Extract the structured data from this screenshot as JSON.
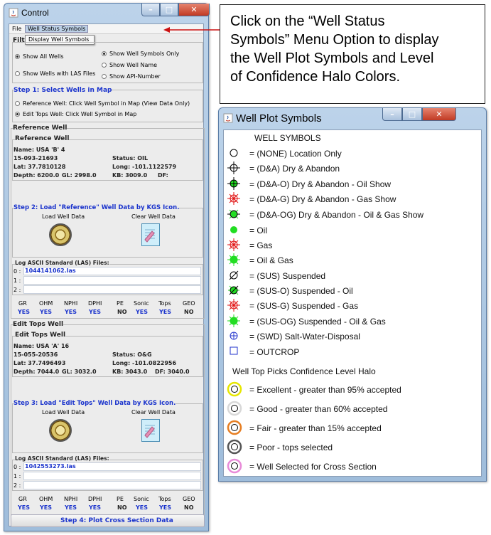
{
  "control": {
    "title": "Control",
    "menu": {
      "file": "File",
      "well_status_symbols": "Well Status Symbols",
      "dropdown_item": "Display Well Symbols"
    },
    "filter_label": "Filt",
    "radios": {
      "show_all": "Show All Wells",
      "show_las": "Show Wells with LAS Files",
      "symbols_only": "Show Well Symbols Only",
      "well_name": "Show Well Name",
      "api_number": "Show API-Number"
    },
    "step1": {
      "title": "Step 1: Select Wells in Map",
      "ref_option": "Reference Well: Click Well Symbol in Map (View Data Only)",
      "edit_option": "Edit Tops Well: Click Well Symbol in Map"
    },
    "reference": {
      "outer": "Reference Well",
      "inner": "Reference Well",
      "name": "Name: USA 'B' 4",
      "api": "15-093-21693",
      "status": "Status: OIL",
      "lat": "Lat: 37.7810128",
      "long": "Long: -101.1122579",
      "depth": "Depth: 6200.0",
      "gl": "GL: 2998.0",
      "kb": "KB: 3009.0",
      "df": "DF:",
      "step": "Step 2: Load \"Reference\" Well Data by KGS Icon.",
      "load": "Load Well Data",
      "clear": "Clear Well Data",
      "las_title": "Log ASCII Standard (LAS) Files:",
      "las_rows": [
        "0 :",
        "1 :",
        "2 :"
      ],
      "las_file": "1044141062.las",
      "logs": [
        "GR",
        "OHM",
        "NPHI",
        "DPHI",
        "PE",
        "Sonic",
        "Tops",
        "GEO"
      ],
      "flags": [
        "YES",
        "YES",
        "YES",
        "YES",
        "NO",
        "YES",
        "YES",
        "NO"
      ]
    },
    "edit": {
      "outer": "Edit Tops Well",
      "inner": "Edit Tops Well",
      "name": "Name: USA 'A' 16",
      "api": "15-055-20536",
      "status": "Status: O&G",
      "lat": "Lat: 37.7496493",
      "long": "Long: -101.0822956",
      "depth": "Depth: 7044.0",
      "gl": "GL: 3032.0",
      "kb": "KB: 3043.0",
      "df": "DF: 3040.0",
      "step": "Step 3: Load \"Edit Tops\" Well Data by KGS Icon.",
      "load": "Load Well Data",
      "clear": "Clear Well Data",
      "las_title": "Log ASCII Standard (LAS) Files:",
      "las_rows": [
        "0 :",
        "1 :",
        "2 :"
      ],
      "las_file": "1042553273.las",
      "logs": [
        "GR",
        "OHM",
        "NPHI",
        "DPHI",
        "PE",
        "Sonic",
        "Tops",
        "GEO"
      ],
      "flags": [
        "YES",
        "YES",
        "YES",
        "YES",
        "NO",
        "YES",
        "YES",
        "NO"
      ]
    },
    "step4": "Step 4: Plot Cross Section Data"
  },
  "callout": {
    "lines": [
      "Click on the “Well Status",
      "Symbols” Menu Option  to display",
      "the Well Plot Symbols and Level",
      "of Confidence Halo Colors."
    ]
  },
  "symbols": {
    "title": "Well Plot Symbols",
    "header": "WELL SYMBOLS",
    "items": [
      "= (NONE) Location Only",
      "= (D&A) Dry & Abandon",
      "= (D&A-O) Dry & Abandon - Oil Show",
      "= (D&A-G) Dry & Abandon - Gas Show",
      "= (D&A-OG) Dry & Abandon - Oil & Gas Show",
      "= Oil",
      "= Gas",
      "= Oil & Gas",
      "= (SUS) Suspended",
      "= (SUS-O) Suspended - Oil",
      "= (SUS-G) Suspended - Gas",
      "= (SUS-OG) Suspended - Oil & Gas",
      "= (SWD) Salt-Water-Disposal",
      "= OUTCROP"
    ],
    "halo_header": "Well Top Picks Confidence Level Halo",
    "halos": [
      {
        "label": "= Excellent - greater than 95% accepted",
        "color": "#e6e600"
      },
      {
        "label": "= Good - greater than 60% accepted",
        "color": "#d8d8d8"
      },
      {
        "label": "= Fair - greater than 15% accepted",
        "color": "#e67e22"
      },
      {
        "label": "= Poor - tops selected",
        "color": "#555555"
      },
      {
        "label": "= Well Selected for Cross Section",
        "color": "#e88ad8"
      }
    ]
  }
}
